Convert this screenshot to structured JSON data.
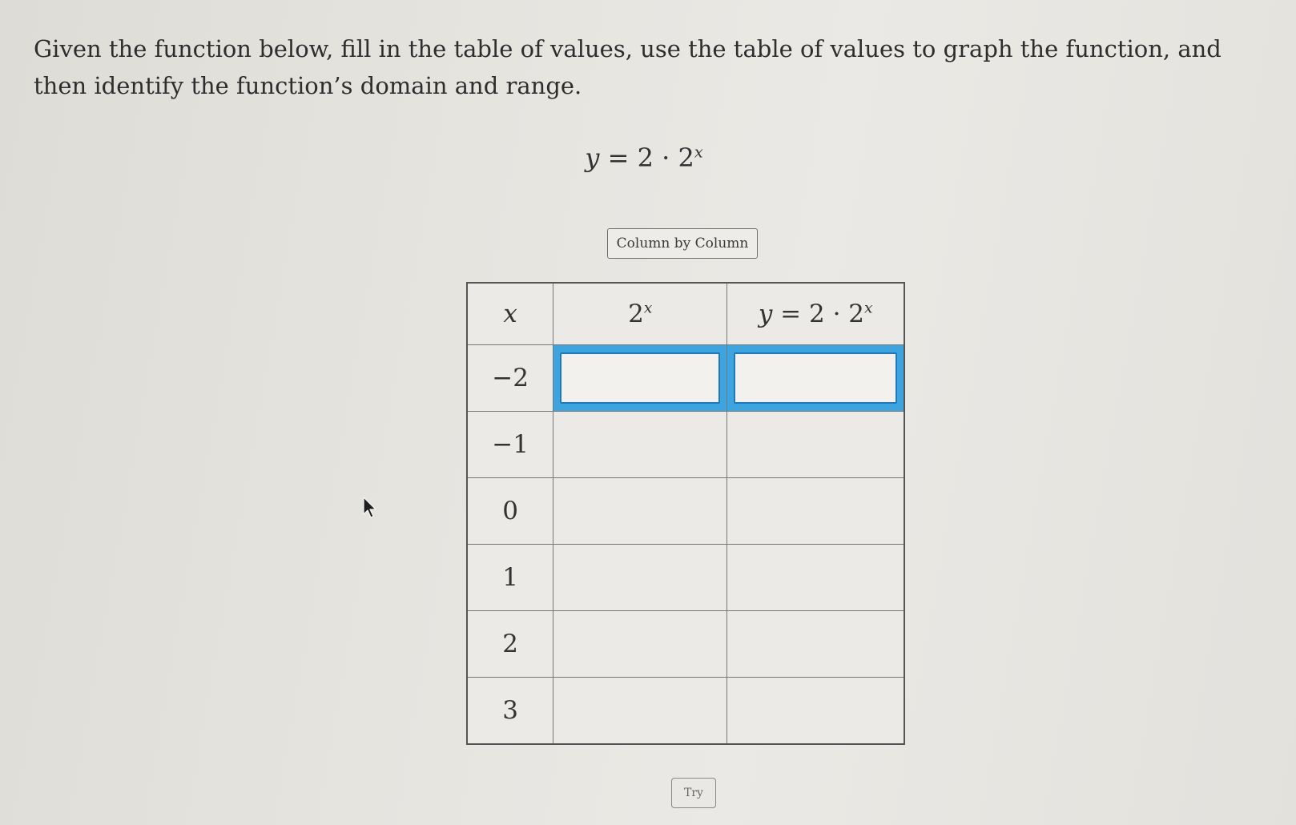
{
  "instructions": "Given the function below, fill in the table of values, use the table of values to graph the function, and then identify the function’s domain and range.",
  "equation": {
    "lhs": "y",
    "eq": "=",
    "coef": "2 · 2",
    "exp": "x"
  },
  "column_button": "Column by Column",
  "table": {
    "headers": {
      "x_var": "x",
      "pow_base": "2",
      "pow_exp": "x",
      "y_lhs": "y",
      "y_mid": " = 2 · 2",
      "y_exp": "x"
    },
    "rows": [
      {
        "x": "−2",
        "pow": "",
        "y": ""
      },
      {
        "x": "−1",
        "pow": "",
        "y": ""
      },
      {
        "x": "0",
        "pow": "",
        "y": ""
      },
      {
        "x": "1",
        "pow": "",
        "y": ""
      },
      {
        "x": "2",
        "pow": "",
        "y": ""
      },
      {
        "x": "3",
        "pow": "",
        "y": ""
      }
    ]
  },
  "try_button": "Try",
  "colors": {
    "active_row_highlight": "#3da4e0",
    "input_border": "#1f78b8"
  },
  "icons": [
    "mouse-pointer-icon"
  ]
}
